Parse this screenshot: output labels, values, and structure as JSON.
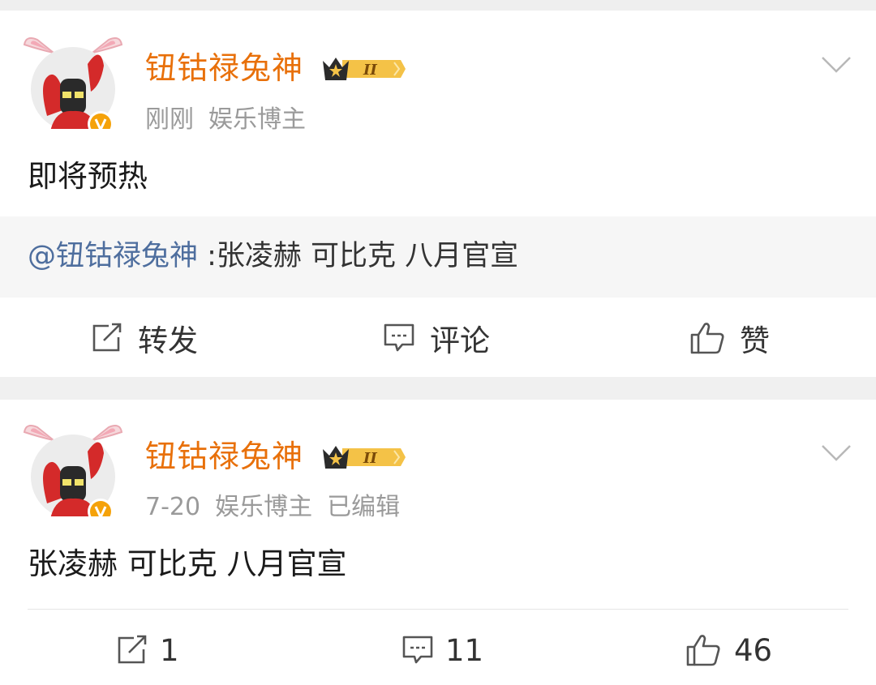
{
  "posts": [
    {
      "username": "钮钴禄兔神",
      "vip_level": "II",
      "time": "刚刚",
      "tag": "娱乐博主",
      "edited": "",
      "text": "即将预热",
      "repost": {
        "mention": "@钮钴禄兔神",
        "text": " :张凌赫  可比克  八月官宣"
      },
      "actions": {
        "repost": "转发",
        "comment": "评论",
        "like": "赞"
      }
    },
    {
      "username": "钮钴禄兔神",
      "vip_level": "II",
      "time": "7-20",
      "tag": "娱乐博主",
      "edited": "已编辑",
      "text": "张凌赫  可比克  八月官宣",
      "actions": {
        "repost": "1",
        "comment": "11",
        "like": "46"
      }
    }
  ],
  "colors": {
    "username": "#e8700a",
    "mention": "#4e6e9e",
    "verified": "#f5a20a",
    "meta": "#9a9a9a"
  },
  "icons": [
    "avatar-rabbit-ears",
    "verified-v-badge",
    "vip-crown-badge",
    "chevron-down-icon",
    "share-icon",
    "comment-icon",
    "like-icon"
  ]
}
